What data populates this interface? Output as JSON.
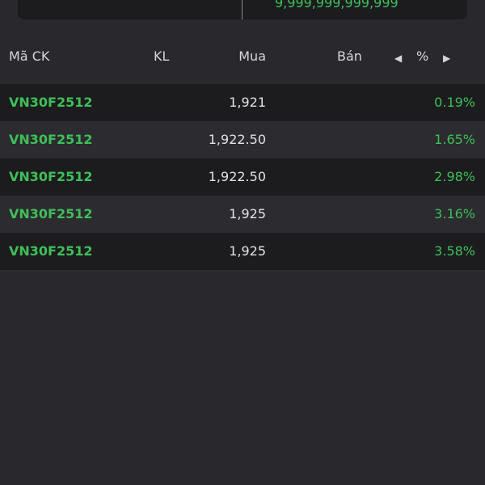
{
  "top_card": {
    "value": "9,999,999,999,999"
  },
  "header": {
    "code": "Mã CK",
    "volume": "KL",
    "buy": "Mua",
    "sell": "Bán",
    "pct": "%"
  },
  "rows": [
    {
      "code": "VN30F2512",
      "buy": "1,921",
      "pct": "0.19%"
    },
    {
      "code": "VN30F2512",
      "buy": "1,922.50",
      "pct": "1.65%"
    },
    {
      "code": "VN30F2512",
      "buy": "1,922.50",
      "pct": "2.98%"
    },
    {
      "code": "VN30F2512",
      "buy": "1,925",
      "pct": "3.16%"
    },
    {
      "code": "VN30F2512",
      "buy": "1,925",
      "pct": "3.58%"
    }
  ],
  "colors": {
    "positive": "#3fbf58",
    "background": "#29292d",
    "row_dark": "#1c1c1f"
  }
}
